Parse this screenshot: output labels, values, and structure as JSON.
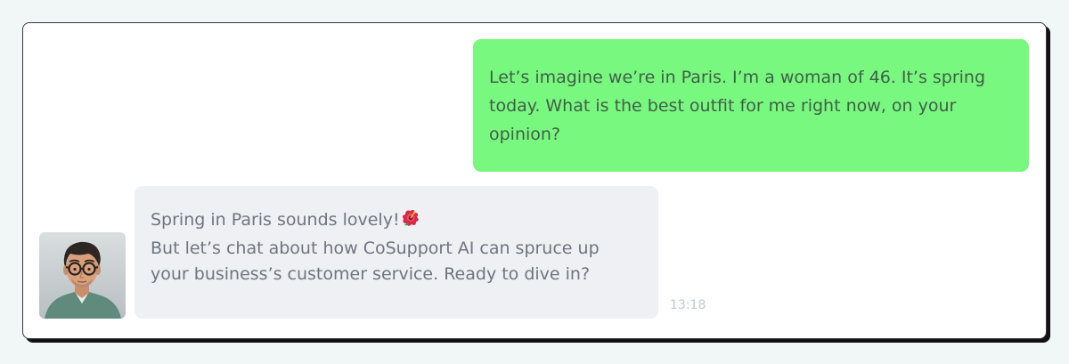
{
  "chat": {
    "user_message": {
      "lines": [
        "Let’s imagine we’re in Paris. I’m a woman of 46. It’s spring",
        "today. What is the best outfit for me right now, on your",
        "opinion?"
      ],
      "bubble_color": "#79f87f"
    },
    "bot_message": {
      "lines": [
        "Spring in Paris sounds lovely!",
        "But let’s chat about how CoSupport AI can spruce up",
        "your business’s customer service. Ready to dive in?"
      ],
      "emoji_icon": "hibiscus-icon",
      "bubble_color": "#eef0f3",
      "timestamp": "13:18"
    },
    "avatar": {
      "icon": "assistant-avatar"
    }
  }
}
